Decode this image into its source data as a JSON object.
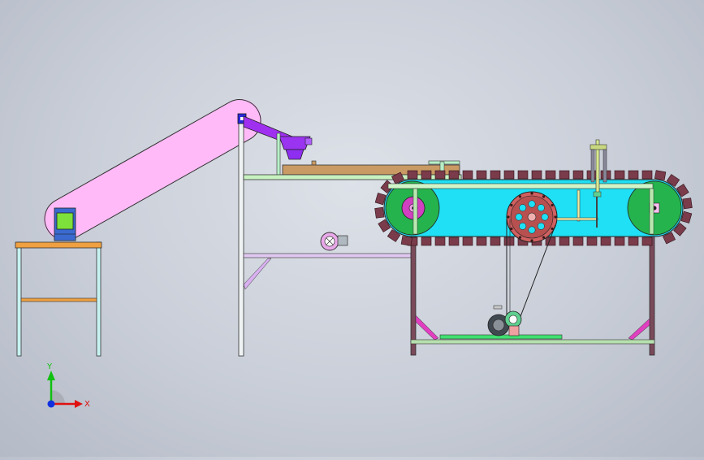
{
  "triad": {
    "x_label": "X",
    "y_label": "Y",
    "x_color": "#e01010",
    "y_color": "#10c010",
    "z_color": "#1030e0"
  },
  "colors": {
    "incline_belt": "#ffbaf7",
    "frame_light": "#c8f2f2",
    "frame_dark": "#7a4a5a",
    "track_shoe": "#7a3b4a",
    "track_body": "#1fe0f5",
    "end_pulley_fill": "#25b34d",
    "drive_pulley": "#d06060",
    "plank": "#c99a64",
    "hopper_arm": "#a030f0",
    "orange_rail": "#f0a040",
    "brace_pink": "#e040c0"
  }
}
